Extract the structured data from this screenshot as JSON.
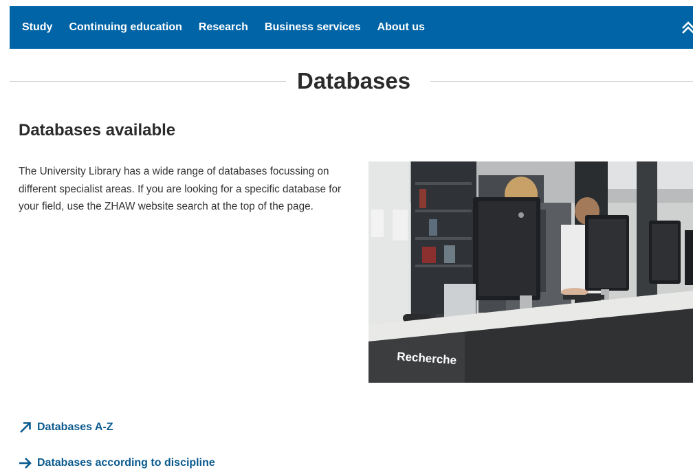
{
  "nav": {
    "items": [
      "Study",
      "Continuing education",
      "Research",
      "Business services",
      "About us"
    ]
  },
  "page": {
    "title": "Databases"
  },
  "section": {
    "title": "Databases available",
    "paragraph": "The University Library has a wide range of databases focussing on different specialist areas. If you are looking for a specific database for your field, use the ZHAW website search at the top of the page."
  },
  "image": {
    "sign_text": "Recherche"
  },
  "links": {
    "databases_az": "Databases A-Z",
    "databases_discipline": "Databases according to discipline"
  },
  "colors": {
    "nav_background": "#0064a6",
    "link": "#0b5a8e"
  },
  "icons": {
    "nav_right": "double-chevron-up-icon",
    "link_az": "arrow-up-right-icon",
    "link_discipline": "arrow-right-icon"
  }
}
